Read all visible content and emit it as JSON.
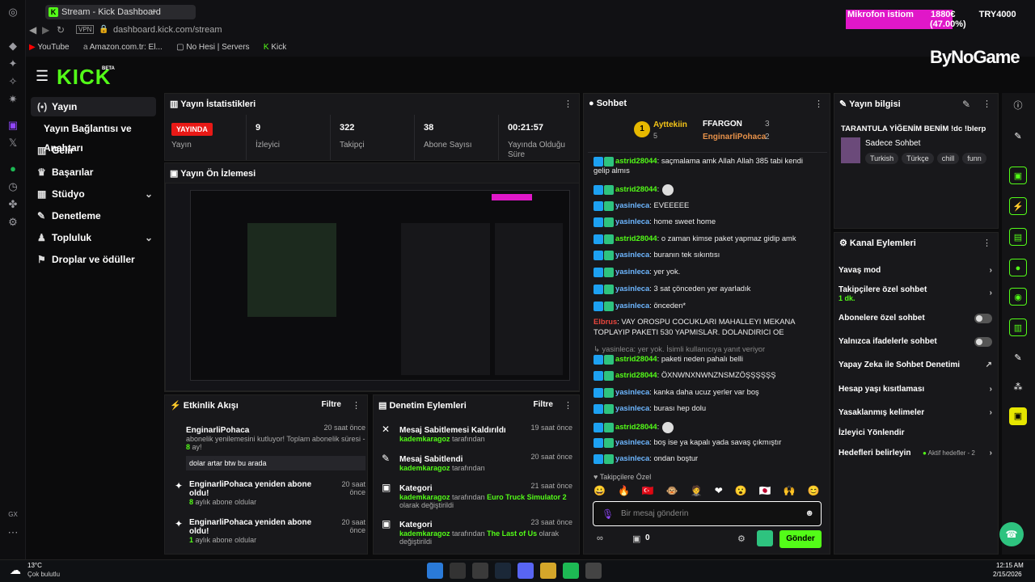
{
  "browser": {
    "tab_title": "Stream - Kick Dashboard",
    "url": "dashboard.kick.com/stream",
    "vpn": "VPN",
    "bookmarks": [
      "YouTube",
      "Amazon.com.tr: El...",
      "No Hesi | Servers",
      "Kick"
    ]
  },
  "overlay": {
    "mic_label": "Mikrofon istiom",
    "mic_value": "1880€",
    "mic_percent": "(47.00%)",
    "try": "TRY4000",
    "brand": "ByNoGame"
  },
  "sidebar": {
    "logo": "KICK",
    "logo_beta": "BETA",
    "items": [
      {
        "label": "Yayın",
        "icon": "(•)"
      },
      {
        "label": "Yayın Bağlantısı ve Anahtarı",
        "icon": ""
      },
      {
        "label": "Gelir",
        "icon": "▥"
      },
      {
        "label": "Başarılar",
        "icon": "♛"
      },
      {
        "label": "Stüdyo",
        "icon": "▦"
      },
      {
        "label": "Denetleme",
        "icon": "✎"
      },
      {
        "label": "Topluluk",
        "icon": "♟"
      },
      {
        "label": "Droplar ve ödüller",
        "icon": "⚑"
      }
    ],
    "gx": "GX"
  },
  "stats": {
    "title": "Yayın İstatistikleri",
    "live_badge": "YAYINDA",
    "live_label": "Yayın",
    "viewers": "9",
    "viewers_label": "İzleyici",
    "followers": "322",
    "followers_label": "Takipçi",
    "subs": "38",
    "subs_label": "Abone Sayısı",
    "uptime": "00:21:57",
    "uptime_label": "Yayında Olduğu Süre"
  },
  "preview": {
    "title": "Yayın Ön İzlemesi"
  },
  "events": {
    "title": "Etkinlik Akışı",
    "filter": "Filtre",
    "items": [
      {
        "user": "EnginarliPohaca",
        "time": "20 saat önce",
        "text": "abonelik yenilemesini kutluyor! Toplam abonelik süresi -",
        "months": "8",
        "months_suffix": "ay!",
        "msg": "dolar artar btw bu arada"
      },
      {
        "user": "EnginarliPohaca yeniden abone oldu!",
        "time": "20 saat önce",
        "months": "8",
        "text": "aylık abone oldular"
      },
      {
        "user": "EnginarliPohaca yeniden abone oldu!",
        "time": "20 saat önce",
        "months": "1",
        "text": "aylık abone oldular"
      }
    ]
  },
  "moderation": {
    "title": "Denetim Eylemleri",
    "filter": "Filtre",
    "items": [
      {
        "action": "Mesaj Sabitlemesi Kaldırıldı",
        "time": "19 saat önce",
        "by": "kademkaragoz",
        "by_suffix": "tarafından"
      },
      {
        "action": "Mesaj Sabitlendi",
        "time": "20 saat önce",
        "by": "kademkaragoz",
        "by_suffix": "tarafından"
      },
      {
        "action": "Kategori",
        "time": "21 saat önce",
        "by": "kademkaragoz",
        "by_suffix": "tarafından",
        "category": "Euro Truck Simulator 2",
        "suffix": "olarak değiştirildi"
      },
      {
        "action": "Kategori",
        "time": "23 saat önce",
        "by": "kademkaragoz",
        "by_suffix": "tarafından",
        "category": "The Last of Us",
        "suffix": "olarak değiştirildi"
      }
    ]
  },
  "chat": {
    "title": "Sohbet",
    "top1": "Ayttekiin",
    "top1_n": "5",
    "top2": "FFARGON",
    "top2_n": "3",
    "top3": "EnginarliPohaca",
    "top3_n": "2",
    "placeholder": "Bir mesaj gönderin",
    "followers_only": "Takipçilere Özel",
    "send": "Gönder",
    "count": "0",
    "lines": [
      {
        "u": "astrid28044",
        "c": "u1",
        "m": ": saçmalama amk Allah Allah 385 tabi kendi"
      },
      {
        "u": "",
        "c": "",
        "m": "gelip almıs"
      },
      {
        "u": "astrid28044",
        "c": "u1",
        "m": ":"
      },
      {
        "u": "yasinleca",
        "c": "u2",
        "m": ": EVEEEEE"
      },
      {
        "u": "yasinleca",
        "c": "u2",
        "m": ": home sweet home"
      },
      {
        "u": "astrid28044",
        "c": "u1",
        "m": ": o zaman kimse paket yapmaz gidip amk"
      },
      {
        "u": "yasinleca",
        "c": "u2",
        "m": ": buranın tek sıkıntısı"
      },
      {
        "u": "yasinleca",
        "c": "u2",
        "m": ": yer yok."
      },
      {
        "u": "yasinleca",
        "c": "u2",
        "m": ": 3 sat çönceden yer ayarladık"
      },
      {
        "u": "yasinleca",
        "c": "u2",
        "m": ": önceden*"
      },
      {
        "u": "Elbrus",
        "c": "u3",
        "m": ": VAY OROSPU COCUKLARI MAHALLEYI MEKANA"
      },
      {
        "u": "",
        "c": "",
        "m": "TOPLAYIP PAKETI 530 YAPMISLAR. DOLANDIRICI OE"
      },
      {
        "u": "",
        "c": "",
        "m": "↳ yasinleca: yer yok. İsimli kullanıcıya yanıt veriyor"
      },
      {
        "u": "astrid28044",
        "c": "u1",
        "m": ": paketi neden pahalı belli"
      },
      {
        "u": "astrid28044",
        "c": "u1",
        "m": ": ÖXNWNXNWNZNSMZÖŞŞŞŞŞŞ"
      },
      {
        "u": "yasinleca",
        "c": "u2",
        "m": ": kanka daha ucuz yerler var boş"
      },
      {
        "u": "yasinleca",
        "c": "u2",
        "m": ": burası hep dolu"
      },
      {
        "u": "astrid28044",
        "c": "u1",
        "m": ":"
      },
      {
        "u": "yasinleca",
        "c": "u2",
        "m": ": boş ise ya kapalı yada savaş çıkmıştır"
      },
      {
        "u": "yasinleca",
        "c": "u2",
        "m": ": ondan boştur"
      }
    ]
  },
  "info": {
    "title": "Yayın bilgisi",
    "stream_title": "TARANTULA YİĞENİM BENİM !dc !blerp",
    "category": "Sadece Sohbet",
    "tags": [
      "Turkish",
      "Türkçe",
      "chill",
      "funn"
    ]
  },
  "channel_actions": {
    "title": "Kanal Eylemleri",
    "slow": "Yavaş mod",
    "followers": "Takipçilere özel sohbet",
    "followers_sub": "1 dk.",
    "subs": "Abonelere özel sohbet",
    "emotes": "Yalnızca ifadelerle sohbet",
    "ai": "Yapay Zeka ile Sohbet Denetimi",
    "age": "Hesap yaşı kısıtlaması",
    "banned": "Yasaklanmış kelimeler",
    "viewer": "İzleyici Yönlendir",
    "goals": "Hedefleri belirleyin",
    "goals_sub": "Aktif hedefler - 2"
  },
  "taskbar": {
    "temp": "13°C",
    "weather": "Çok bulutlu",
    "time": "12:15 AM",
    "date": "2/15/2026"
  }
}
